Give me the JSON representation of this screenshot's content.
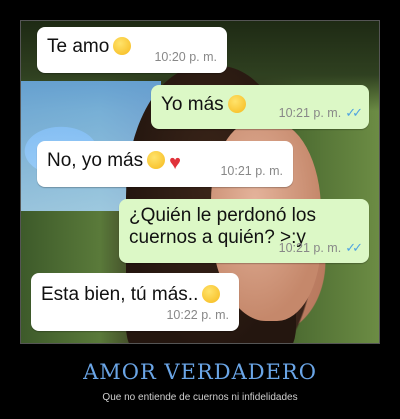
{
  "chat": {
    "messages": [
      {
        "direction": "incoming",
        "text": "Te amo",
        "emoji": "heart-eyes-emoji",
        "time": "10:20 p. m."
      },
      {
        "direction": "outgoing",
        "text": "Yo más",
        "emoji": "smiling-face-emoji",
        "time": "10:21 p. m.",
        "status": "read-double-check"
      },
      {
        "direction": "incoming",
        "text": "No, yo más",
        "emoji": "heart-eyes-emoji red-heart-emoji",
        "time": "10:21 p. m."
      },
      {
        "direction": "outgoing",
        "text_line1": "¿Quién le perdonó los",
        "text_line2": "cuernos a quién? >:y",
        "time": "10:21 p. m.",
        "status": "read-double-check"
      },
      {
        "direction": "incoming",
        "text": "Esta bien, tú más..",
        "emoji": "sweat-smile-emoji",
        "time": "10:22 p. m."
      }
    ]
  },
  "caption": {
    "title": "AMOR VERDADERO",
    "subtitle": "Que no entiende de cuernos ni infidelidades"
  },
  "colors": {
    "incoming_bubble": "#ffffff",
    "outgoing_bubble": "#dcf8c6",
    "read_ticks": "#4fa3e0",
    "caption_title": "#6aa5e6",
    "background": "#000000"
  }
}
